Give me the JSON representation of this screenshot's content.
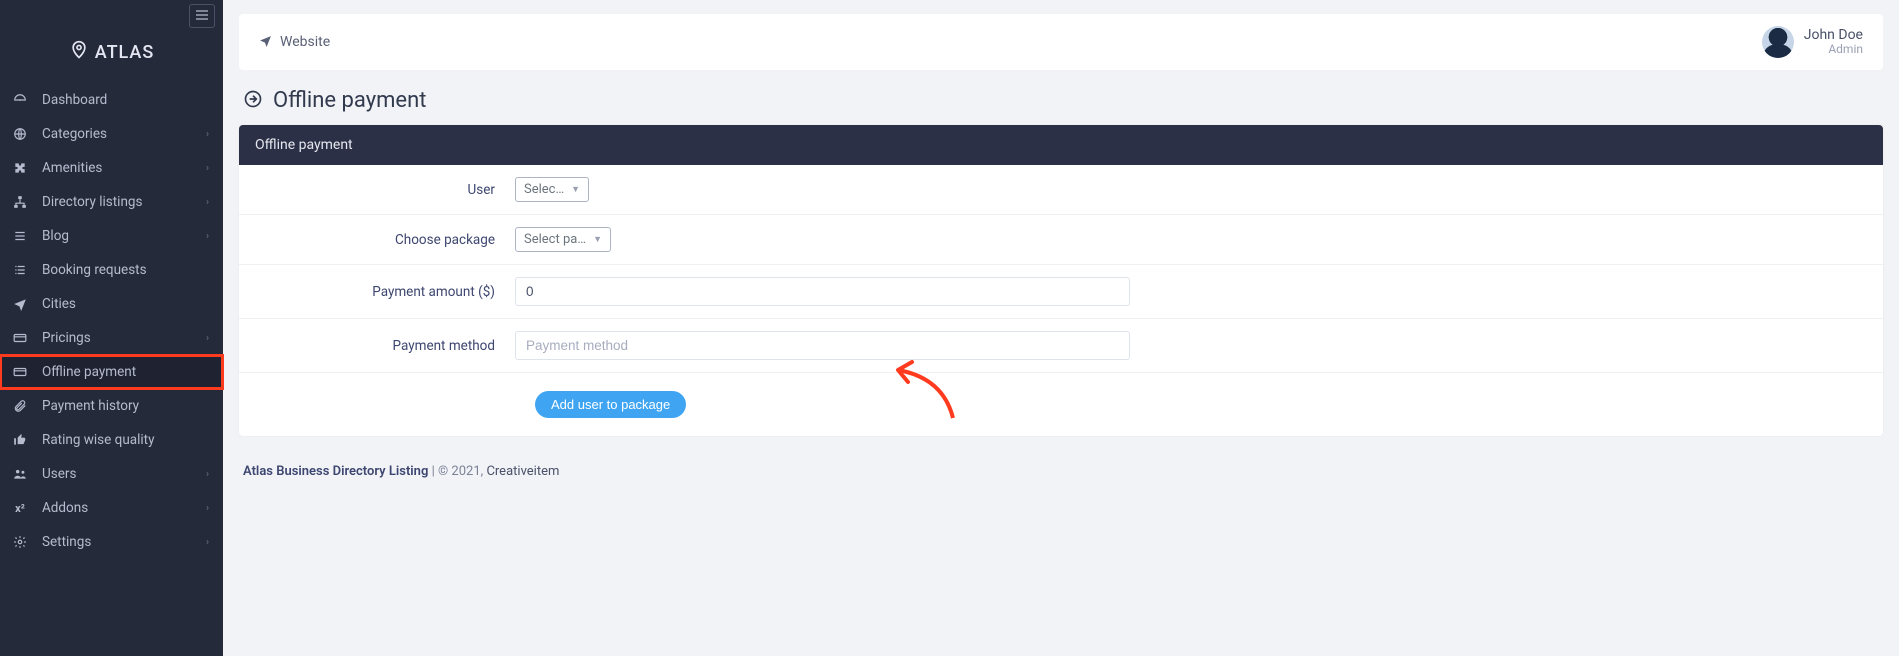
{
  "brand": {
    "name": "ATLAS"
  },
  "sidebar": {
    "items": [
      {
        "label": "Dashboard",
        "icon": "gauge",
        "chev": false
      },
      {
        "label": "Categories",
        "icon": "globe",
        "chev": true
      },
      {
        "label": "Amenities",
        "icon": "puzzle",
        "chev": true
      },
      {
        "label": "Directory listings",
        "icon": "sitemap",
        "chev": true
      },
      {
        "label": "Blog",
        "icon": "list",
        "chev": true
      },
      {
        "label": "Booking requests",
        "icon": "tasks",
        "chev": false
      },
      {
        "label": "Cities",
        "icon": "plane",
        "chev": false
      },
      {
        "label": "Pricings",
        "icon": "card",
        "chev": true
      },
      {
        "label": "Offline payment",
        "icon": "card",
        "chev": false
      },
      {
        "label": "Payment history",
        "icon": "clip",
        "chev": false
      },
      {
        "label": "Rating wise quality",
        "icon": "thumb",
        "chev": false
      },
      {
        "label": "Users",
        "icon": "users",
        "chev": true
      },
      {
        "label": "Addons",
        "icon": "x2",
        "chev": true
      },
      {
        "label": "Settings",
        "icon": "cogs",
        "chev": true
      }
    ]
  },
  "topbar": {
    "website_label": "Website",
    "user": {
      "name": "John Doe",
      "role": "Admin"
    }
  },
  "page": {
    "title": "Offline payment",
    "card_title": "Offline payment"
  },
  "form": {
    "labels": {
      "user": "User",
      "package": "Choose package",
      "amount": "Payment amount ($)",
      "method": "Payment method"
    },
    "user_select": "Select u…",
    "package_select": "Select packa…",
    "amount_value": "0",
    "method_placeholder": "Payment method",
    "submit_label": "Add user to package"
  },
  "footer": {
    "brand": "Atlas Business Directory Listing",
    "mid": " | © 2021, ",
    "credit": "Creativeitem"
  }
}
